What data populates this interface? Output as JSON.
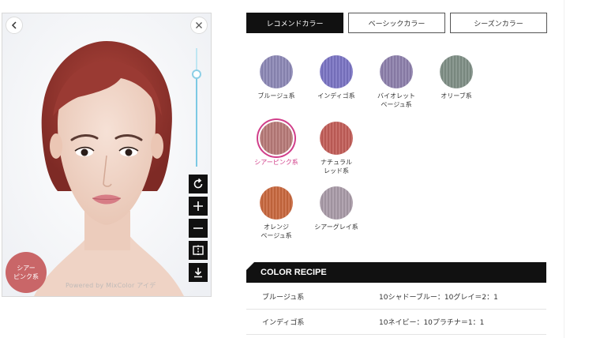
{
  "preview": {
    "current_color_line1": "シアー",
    "current_color_line2": "ピンク系",
    "powered_by": "Powered by MixColor アイデ",
    "zoom_level": 0.82,
    "icons": {
      "back": "chevron-left-icon",
      "close": "close-icon",
      "reset": "rotate-icon",
      "zoom_in": "plus-icon",
      "zoom_out": "minus-icon",
      "compare": "compare-icon",
      "download": "download-icon"
    }
  },
  "tabs": [
    {
      "label": "レコメンドカラー",
      "active": true
    },
    {
      "label": "ベーシックカラー",
      "active": false
    },
    {
      "label": "シーズンカラー",
      "active": false
    }
  ],
  "swatches": [
    {
      "lines": [
        "ブルージュ系"
      ],
      "color": "#8c88b6",
      "selected": false
    },
    {
      "lines": [
        "インディゴ系"
      ],
      "color": "#7a74c4",
      "selected": false
    },
    {
      "lines": [
        "バイオレット",
        "ベージュ系"
      ],
      "color": "#8d80ac",
      "selected": false
    },
    {
      "lines": [
        "オリーブ系"
      ],
      "color": "#7f8f86",
      "selected": false
    },
    {
      "lines": [
        "シアーピンク系"
      ],
      "color": "#b87a78",
      "selected": true
    },
    {
      "lines": [
        "ナチュラル",
        "レッド系"
      ],
      "color": "#c25d58",
      "selected": false
    },
    {
      "lines": [
        "オレンジ",
        "ベージュ系"
      ],
      "color": "#c9683e",
      "selected": false
    },
    {
      "lines": [
        "シアーグレイ系"
      ],
      "color": "#a99ba8",
      "selected": false
    }
  ],
  "recipe": {
    "title": "COLOR RECIPE",
    "rows": [
      {
        "name": "ブルージュ系",
        "formula": "10シャドーブルー：10グレイ＝2：1"
      },
      {
        "name": "インディゴ系",
        "formula": "10ネイビー：10プラチナ＝1：1"
      }
    ]
  },
  "colors": {
    "accent": "#d13f8a",
    "badge": "#c96668",
    "tab_active": "#111111",
    "slider": "#7cc9e4"
  }
}
